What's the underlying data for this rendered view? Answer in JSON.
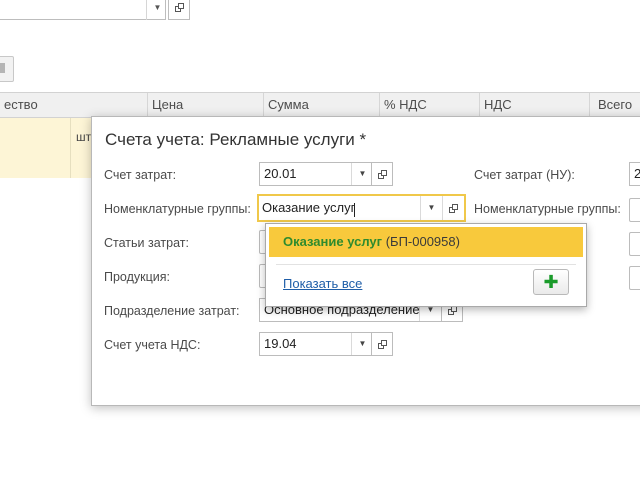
{
  "background": {
    "table_headers": [
      "ество",
      "Цена",
      "Сумма",
      "% НДС",
      "НДС",
      "Всего"
    ],
    "row_unit": "шт"
  },
  "dialog": {
    "title": "Счета учета: Рекламные услуги *",
    "left": {
      "cost_account_label": "Счет затрат:",
      "cost_account_value": "20.01",
      "nomenclature_groups_label": "Номенклатурные группы:",
      "nomenclature_groups_value": "Оказание услуг",
      "cost_items_label": "Статьи затрат:",
      "products_label": "Продукция:",
      "cost_division_label": "Подразделение затрат:",
      "cost_division_value": "Основное подразделение",
      "vat_account_label": "Счет учета НДС:",
      "vat_account_value": "19.04"
    },
    "right": {
      "cost_account_nu_label": "Счет затрат (НУ):",
      "cost_account_nu_value": "2",
      "nomenclature_groups_label": "Номенклатурные группы:"
    }
  },
  "dropdown": {
    "item_highlight": "Оказание услуг",
    "item_rest": " (БП-000958)",
    "show_all": "Показать все",
    "add_icon": "plus-icon"
  },
  "colors": {
    "selection": "#f8c93c",
    "focus_border": "#f0c84a",
    "match_text": "#2e8b2e",
    "link": "#1f5ea8",
    "add_plus": "#1a9b2a"
  }
}
